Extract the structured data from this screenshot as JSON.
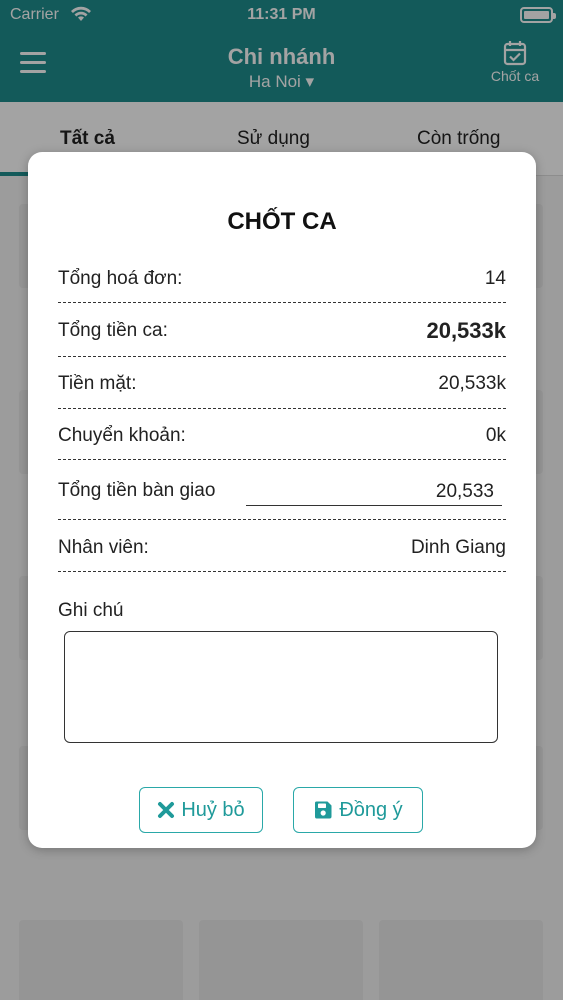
{
  "status_bar": {
    "carrier": "Carrier",
    "time": "11:31 PM"
  },
  "header": {
    "title": "Chi nhánh",
    "branch": "Ha Noi ▾",
    "shift_close_label": "Chốt ca"
  },
  "tabs": [
    {
      "label": "Tất cả",
      "active": true
    },
    {
      "label": "Sử dụng",
      "active": false
    },
    {
      "label": "Còn trống",
      "active": false
    }
  ],
  "colors": {
    "primary": "#1f8e8e",
    "accent": "#2aa8a8"
  },
  "modal": {
    "title": "CHỐT CA",
    "rows": {
      "total_invoices": {
        "label": "Tổng hoá đơn:",
        "value": "14"
      },
      "shift_total": {
        "label": "Tổng tiền ca:",
        "value": "20,533k"
      },
      "cash": {
        "label": "Tiền mặt:",
        "value": "20,533k"
      },
      "transfer": {
        "label": "Chuyển khoản:",
        "value": "0k"
      },
      "handover": {
        "label": "Tổng tiền bàn giao",
        "value": "20,533"
      },
      "staff": {
        "label": "Nhân viên:",
        "value": "Dinh Giang"
      }
    },
    "note_label": "Ghi chú",
    "note_value": "",
    "cancel_label": "Huỷ bỏ",
    "ok_label": "Đồng ý"
  }
}
